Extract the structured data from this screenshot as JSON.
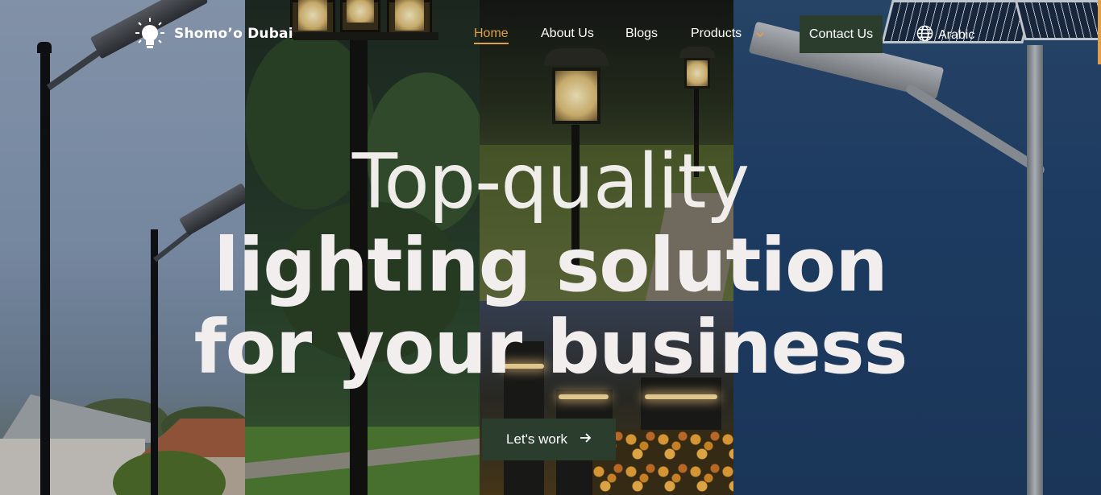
{
  "brand": {
    "name": "Shomo’o Dubai",
    "logo_icon": "lightbulb-icon"
  },
  "nav": {
    "items": [
      {
        "label": "Home",
        "active": true
      },
      {
        "label": "About Us",
        "active": false
      },
      {
        "label": "Blogs",
        "active": false
      },
      {
        "label": "Products",
        "active": false,
        "has_dropdown": true
      }
    ],
    "contact_label": "Contact Us",
    "language_label": "Arabic",
    "language_icon": "globe-icon"
  },
  "hero": {
    "line1": "Top-quality",
    "line2": "lighting solution",
    "line3": "for your business",
    "cta_label": "Let's work",
    "cta_icon": "arrow-right-icon"
  },
  "colors": {
    "accent": "#e0a04a",
    "button_bg": "#2b3d2d",
    "text": "#ffffff"
  }
}
